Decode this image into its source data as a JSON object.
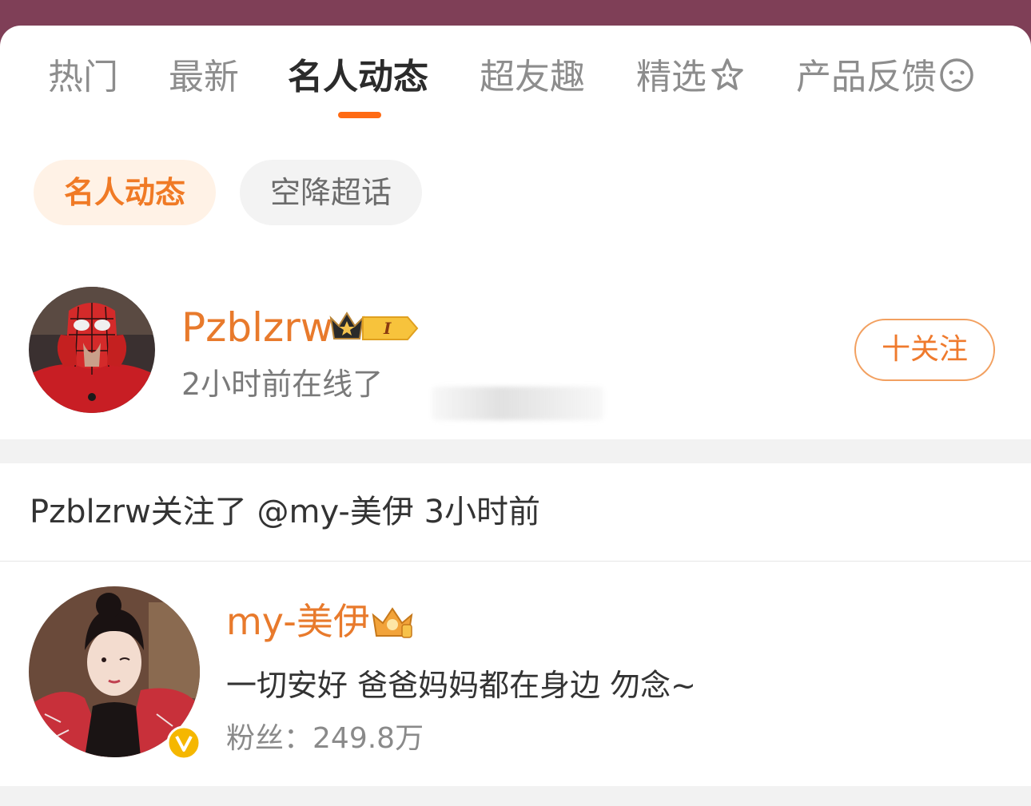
{
  "tabs": [
    {
      "label": "热门"
    },
    {
      "label": "最新"
    },
    {
      "label": "名人动态"
    },
    {
      "label": "超友趣"
    },
    {
      "label": "精选"
    },
    {
      "label": "产品反馈"
    }
  ],
  "active_tab_index": 2,
  "chips": [
    {
      "label": "名人动态",
      "active": true
    },
    {
      "label": "空降超话",
      "active": false
    }
  ],
  "user1": {
    "name": "Pzblzrw",
    "level_badge": "I",
    "status": "2小时前在线了",
    "follow_label": "十关注",
    "avatar_icon": "spiderman-avatar"
  },
  "activity": {
    "text": "Pzblzrw关注了 @my-美伊 3小时前"
  },
  "user2": {
    "name": "my-美伊",
    "bio": "一切安好 爸爸妈妈都在身边 勿念~",
    "fans_label": "粉丝：",
    "fans_count": "249.8万",
    "verified_icon": "v-verified-icon"
  },
  "colors": {
    "accent": "#ff6a13",
    "name_orange": "#e87a2c",
    "header_bg": "#7f3f57"
  }
}
